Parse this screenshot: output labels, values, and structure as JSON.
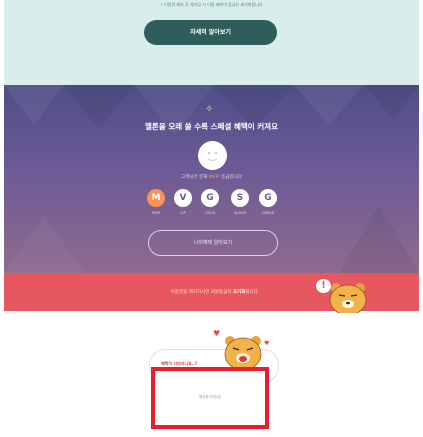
{
  "top": {
    "note": "• 이용권 해지 후 재가입 시 이용 혜택이 등급은 초기화됩니다",
    "detail_button": "자세히 알아보기"
  },
  "promo": {
    "headline": "멜론을 오래 쓸 수록 스페셜 혜택이 커져요",
    "grade_prefix": "고객님은 현재 ",
    "grade_highlight": "MVIP",
    "grade_suffix": " 등급입니다",
    "grades": [
      {
        "letter": "M",
        "label": "MVIP",
        "active": true
      },
      {
        "letter": "V",
        "label": "VIP",
        "active": false
      },
      {
        "letter": "G",
        "label": "GOLD",
        "active": false
      },
      {
        "letter": "S",
        "label": "SILVER",
        "active": false
      },
      {
        "letter": "G",
        "label": "GREEN",
        "active": false
      }
    ],
    "more_button": "나의혜택 알아보기"
  },
  "banner": {
    "text_prefix": "이용권을 해지하시면 회원등급이 ",
    "text_bold": "초기화",
    "text_suffix": "됩니다.",
    "bubble": "!"
  },
  "card": {
    "red_text": "혜택이 사라지나요..?",
    "hint_text": "해지하기(안내)"
  },
  "colors": {
    "mint_bg": "#d8eeea",
    "dark_teal": "#2f5d5b",
    "purple_top": "#4f4e87",
    "orange_active": "#ff8f55",
    "banner_pink": "#e6575f",
    "highlight_red": "#ea1c2d"
  },
  "icons": {
    "sparkle": "✧",
    "heart": "♥"
  }
}
